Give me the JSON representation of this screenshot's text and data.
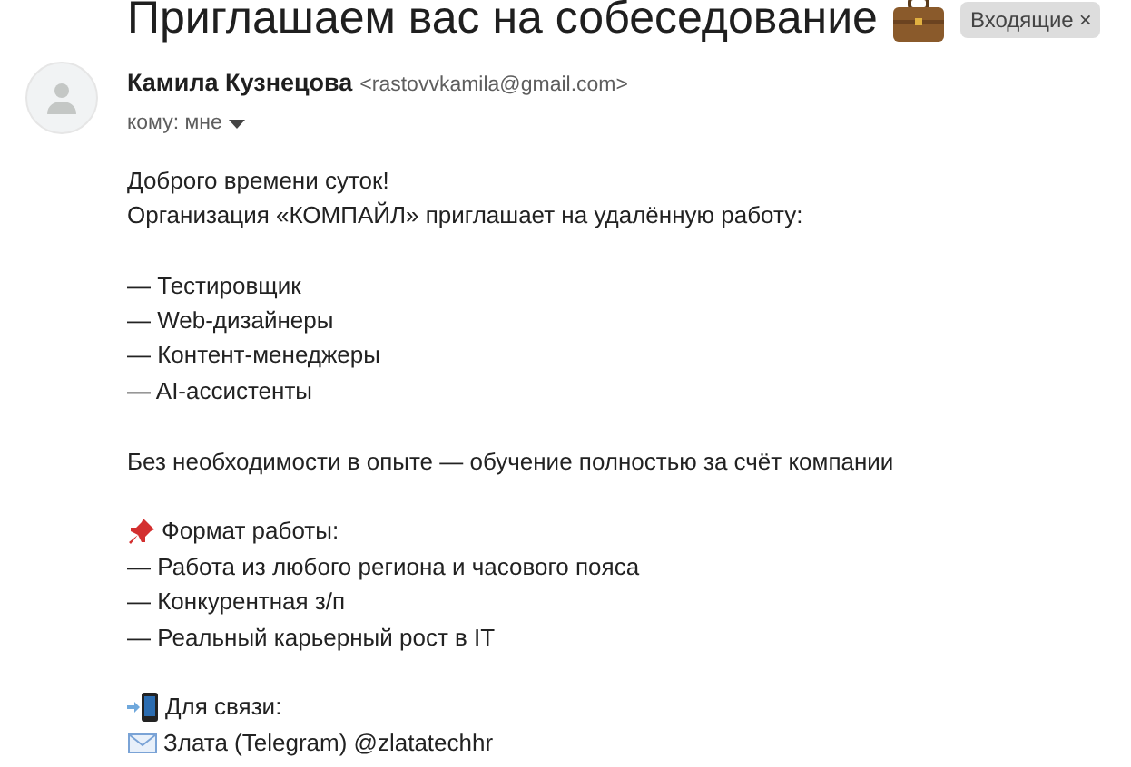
{
  "subject": {
    "text": "Приглашаем вас на собеседование",
    "kind": "briefcase"
  },
  "label": {
    "text": "Входящие",
    "close": "×"
  },
  "sender": {
    "name": "Камила Кузнецова",
    "email": "<rastovvkamila@gmail.com>",
    "to": "кому: мне"
  },
  "body": [
    [
      {
        "text": "Доброго времени суток!"
      },
      {
        "text": "Организация «КОМПАЙЛ» приглашает на удалённую работу:"
      }
    ],
    [
      {
        "text": "— Тестировщик"
      },
      {
        "text": "— Web-дизайнеры"
      },
      {
        "text": "— Контент-менеджеры"
      },
      {
        "text": "— AI-ассистенты"
      }
    ],
    [
      {
        "text": "Без необходимости в опыте — обучение полностью за счёт компании"
      }
    ],
    [
      {
        "text": "Формат работы:",
        "kind": "pin"
      },
      {
        "text": "— Работа из любого региона и часового пояса"
      },
      {
        "text": "— Конкурентная з/п"
      },
      {
        "text": "— Реальный карьерный рост в IT"
      }
    ],
    [
      {
        "text": "Для связи:",
        "kind": "phone"
      },
      {
        "text": "Злата (Telegram) @zlatatechhr",
        "kind": "envelope"
      }
    ]
  ]
}
